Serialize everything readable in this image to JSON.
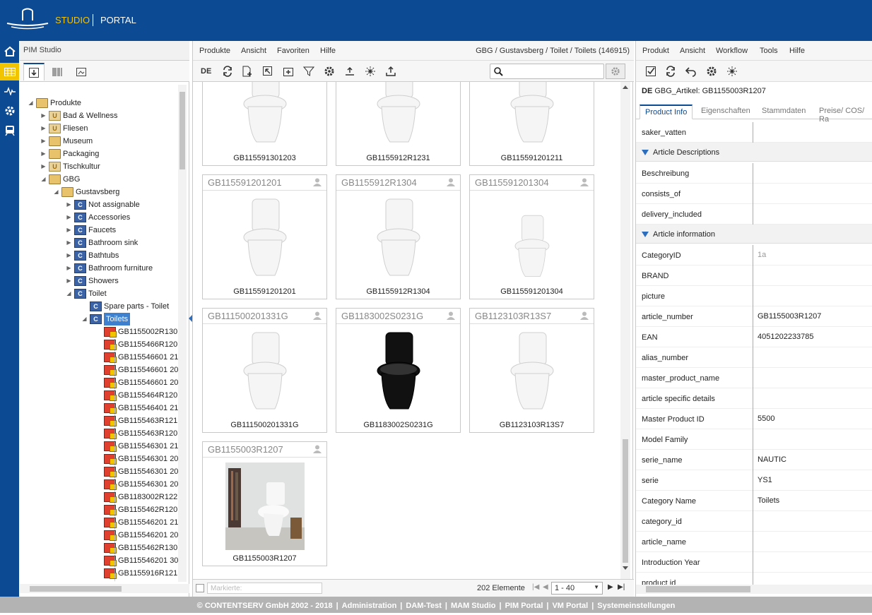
{
  "header": {
    "studio": "STUDIO",
    "portal": "PORTAL"
  },
  "left_panel": {
    "title": "PIM Studio",
    "tree": [
      {
        "label": "Produkte",
        "level": 0,
        "icon": "folder",
        "open": true
      },
      {
        "label": "Bad & Wellness",
        "level": 1,
        "icon": "u"
      },
      {
        "label": "Fliesen",
        "level": 1,
        "icon": "u"
      },
      {
        "label": "Museum",
        "level": 1,
        "icon": "folder"
      },
      {
        "label": "Packaging",
        "level": 1,
        "icon": "folder"
      },
      {
        "label": "Tischkultur",
        "level": 1,
        "icon": "u"
      },
      {
        "label": "GBG",
        "level": 1,
        "icon": "folder",
        "open": true
      },
      {
        "label": "Gustavsberg",
        "level": 2,
        "icon": "folder",
        "open": true
      },
      {
        "label": "Not assignable",
        "level": 3,
        "icon": "c"
      },
      {
        "label": "Accessories",
        "level": 3,
        "icon": "c"
      },
      {
        "label": "Faucets",
        "level": 3,
        "icon": "c"
      },
      {
        "label": "Bathroom sink",
        "level": 3,
        "icon": "c"
      },
      {
        "label": "Bathtubs",
        "level": 3,
        "icon": "c"
      },
      {
        "label": "Bathroom furniture",
        "level": 3,
        "icon": "c"
      },
      {
        "label": "Showers",
        "level": 3,
        "icon": "c"
      },
      {
        "label": "Toilet",
        "level": 3,
        "icon": "c",
        "open": true
      },
      {
        "label": "Spare parts - Toilet",
        "level": 4,
        "icon": "c",
        "leaf": true
      },
      {
        "label": "Toilets",
        "level": 4,
        "icon": "c",
        "open": true,
        "selected": true
      },
      {
        "label": "GB1155002R130",
        "level": 5,
        "icon": "a"
      },
      {
        "label": "GB1155466R120",
        "level": 5,
        "icon": "a"
      },
      {
        "label": "GB115546601 21",
        "level": 5,
        "icon": "a"
      },
      {
        "label": "GB115546601 20",
        "level": 5,
        "icon": "a"
      },
      {
        "label": "GB115546601 20",
        "level": 5,
        "icon": "a"
      },
      {
        "label": "GB1155464R120",
        "level": 5,
        "icon": "a"
      },
      {
        "label": "GB115546401 21",
        "level": 5,
        "icon": "a"
      },
      {
        "label": "GB1155463R121",
        "level": 5,
        "icon": "a"
      },
      {
        "label": "GB1155463R120",
        "level": 5,
        "icon": "a"
      },
      {
        "label": "GB115546301 21",
        "level": 5,
        "icon": "a"
      },
      {
        "label": "GB115546301 20",
        "level": 5,
        "icon": "a"
      },
      {
        "label": "GB115546301 20",
        "level": 5,
        "icon": "a"
      },
      {
        "label": "GB115546301 20",
        "level": 5,
        "icon": "a"
      },
      {
        "label": "GB1183002R122",
        "level": 5,
        "icon": "a"
      },
      {
        "label": "GB1155462R120",
        "level": 5,
        "icon": "a"
      },
      {
        "label": "GB115546201 21",
        "level": 5,
        "icon": "a"
      },
      {
        "label": "GB115546201 20",
        "level": 5,
        "icon": "a"
      },
      {
        "label": "GB1155462R130",
        "level": 5,
        "icon": "a"
      },
      {
        "label": "GB115546201 30",
        "level": 5,
        "icon": "a"
      },
      {
        "label": "GB1155916R121",
        "level": 5,
        "icon": "a"
      }
    ]
  },
  "middle_panel": {
    "menu": [
      "Produkte",
      "Ansicht",
      "Favoriten",
      "Hilfe"
    ],
    "breadcrumb": "GBG / Gustavsberg / Toilet / Toilets (146915)",
    "lang": "DE",
    "cards": [
      {
        "title": "",
        "caption": "GB115591301203",
        "variant": "white-tall",
        "partial": true
      },
      {
        "title": "",
        "caption": "GB1155912R1231",
        "variant": "white-tall",
        "partial": true
      },
      {
        "title": "",
        "caption": "GB115591201211",
        "variant": "white-tall",
        "partial": true
      },
      {
        "title": "GB115591201201",
        "caption": "GB115591201201",
        "variant": "white-tall"
      },
      {
        "title": "GB1155912R1304",
        "caption": "GB1155912R1304",
        "variant": "white-tall"
      },
      {
        "title": "GB115591201304",
        "caption": "GB115591201304",
        "variant": "white-small"
      },
      {
        "title": "GB111500201331G",
        "caption": "GB111500201331G",
        "variant": "white-open"
      },
      {
        "title": "GB1183002S0231G",
        "caption": "GB1183002S0231G",
        "variant": "black"
      },
      {
        "title": "GB1123103R13S7",
        "caption": "GB1123103R13S7",
        "variant": "white-round"
      },
      {
        "title": "GB1155003R1207",
        "caption": "GB1155003R1207",
        "variant": "photo"
      }
    ],
    "markiert_placeholder": "Markierte:",
    "count": "202 Elemente",
    "pager": "1 - 40"
  },
  "right_panel": {
    "menu": [
      "Produkt",
      "Ansicht",
      "Workflow",
      "Tools",
      "Hilfe"
    ],
    "lang": "DE",
    "article": "GBG_Artikel: GB1155003R1207",
    "tabs": [
      "Product Info",
      "Eigenschaften",
      "Stammdaten",
      "Preise/ COS/ Ra"
    ],
    "rows": [
      {
        "key": "saker_vatten",
        "value": ""
      },
      {
        "key": "Article Descriptions",
        "section": true
      },
      {
        "key": "Beschreibung",
        "value": ""
      },
      {
        "key": "consists_of",
        "value": ""
      },
      {
        "key": "delivery_included",
        "value": ""
      },
      {
        "key": "Article information",
        "section": true
      },
      {
        "key": "CategoryID",
        "value": "1a",
        "muted": true
      },
      {
        "key": "BRAND",
        "value": ""
      },
      {
        "key": "picture",
        "value": ""
      },
      {
        "key": "article_number",
        "value": "GB1155003R1207"
      },
      {
        "key": "EAN",
        "value": "4051202233785"
      },
      {
        "key": "alias_number",
        "value": ""
      },
      {
        "key": "master_product_name",
        "value": ""
      },
      {
        "key": "article specific details",
        "value": ""
      },
      {
        "key": "Master Product ID",
        "value": "5500"
      },
      {
        "key": "Model Family",
        "value": ""
      },
      {
        "key": "serie_name",
        "value": "NAUTIC"
      },
      {
        "key": "serie",
        "value": "YS1"
      },
      {
        "key": "Category Name",
        "value": "Toilets"
      },
      {
        "key": "category_id",
        "value": ""
      },
      {
        "key": "article_name",
        "value": ""
      },
      {
        "key": "Introduction Year",
        "value": ""
      },
      {
        "key": "product id",
        "value": ""
      }
    ]
  },
  "footer": [
    "© CONTENTSERV GmbH 2002 - 2018",
    "Administration",
    "DAM-Test",
    "MAM Studio",
    "PIM Portal",
    "VM Portal",
    "Systemeinstellungen"
  ],
  "colors": {
    "brand": "#0c4a93",
    "accent": "#f2c400"
  }
}
